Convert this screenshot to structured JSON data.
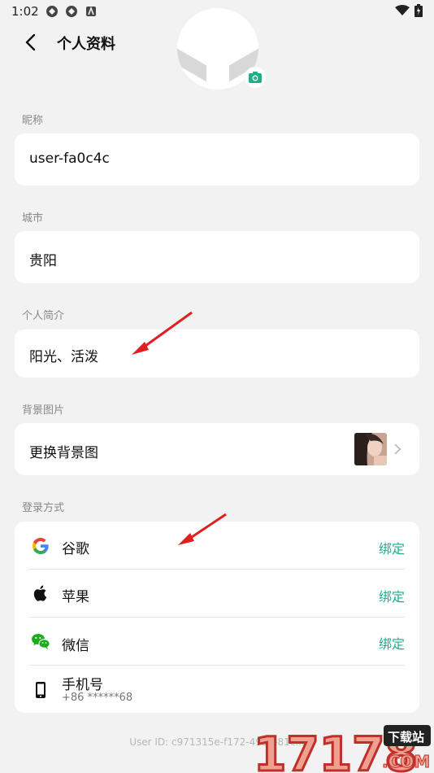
{
  "status": {
    "time": "1:02"
  },
  "header": {
    "title": "个人资料"
  },
  "sections": {
    "nickname": {
      "label": "昵称",
      "value": "user-fa0c4c"
    },
    "city": {
      "label": "城市",
      "value": "贵阳"
    },
    "bio": {
      "label": "个人简介",
      "value": "阳光、活泼"
    },
    "background": {
      "label": "背景图片",
      "value": "更换背景图"
    },
    "login": {
      "label": "登录方式",
      "items": [
        {
          "label": "谷歌",
          "action": "绑定"
        },
        {
          "label": "苹果",
          "action": "绑定"
        },
        {
          "label": "微信",
          "action": "绑定"
        },
        {
          "label": "手机号",
          "sub": "+86 ******68"
        }
      ]
    }
  },
  "footer": {
    "user_id": "User ID: c971315e-f172-4958-81c..."
  },
  "watermark": {
    "text": "17178",
    "site": "下载站",
    "domain": ".COM"
  },
  "colors": {
    "accent": "#1fae8c",
    "background": "#f2f2f2",
    "arrow": "#e02020"
  }
}
